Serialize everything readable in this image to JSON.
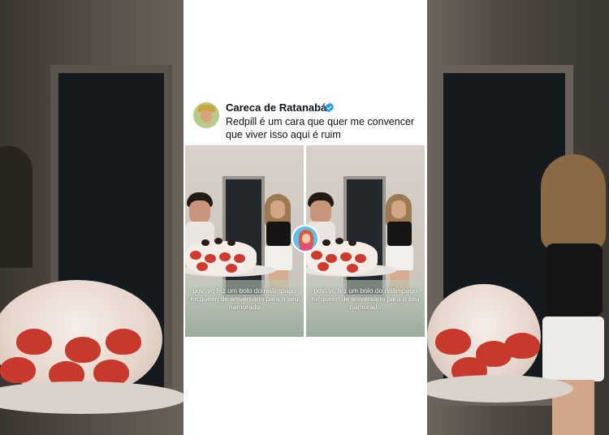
{
  "post": {
    "author_name": "Careca de Ratanabá",
    "verified": true,
    "text": "Redpill é um cara que quer me convencer que viver isso aqui é ruim",
    "avatar_icon": "user-avatar-icon",
    "media": [
      {
        "caption": "pov: vc fez um bolo do relâmpago mcqueen de aniversário para o seu namorado"
      },
      {
        "caption": "pov: vc fez um bolo do relâmpago mcqueen de aniversário para o seu namorado"
      }
    ],
    "sticker_icon": "cartoon-face-sticker"
  },
  "colors": {
    "verified_badge": "#1d9bf0",
    "text": "#0f1419",
    "background": "#ffffff"
  }
}
